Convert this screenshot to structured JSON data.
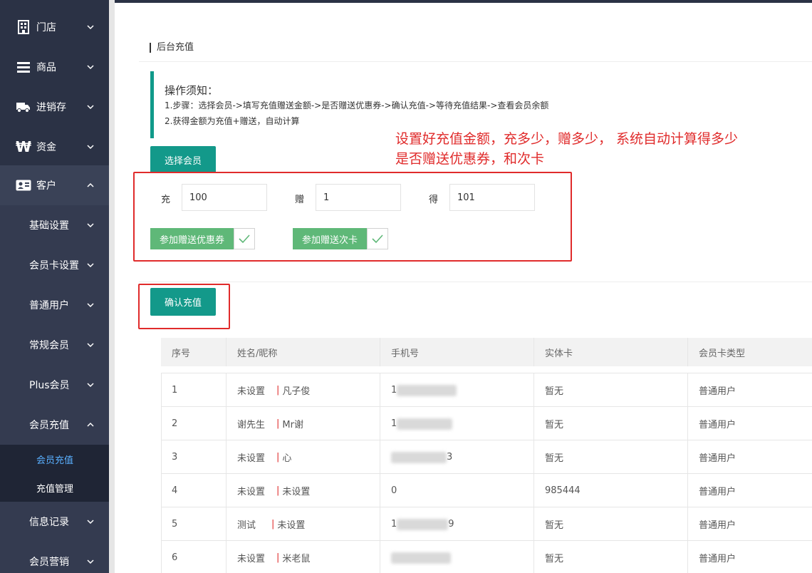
{
  "sidebar": {
    "items": [
      {
        "label": "门店",
        "icon": "building-icon"
      },
      {
        "label": "商品",
        "icon": "list-icon"
      },
      {
        "label": "进销存",
        "icon": "truck-icon"
      },
      {
        "label": "资金",
        "icon": "won-icon"
      },
      {
        "label": "客户",
        "icon": "id-card-icon"
      }
    ],
    "sub_items": [
      {
        "label": "基础设置"
      },
      {
        "label": "会员卡设置"
      },
      {
        "label": "普通用户"
      },
      {
        "label": "常规会员"
      },
      {
        "label": "Plus会员"
      },
      {
        "label": "会员充值"
      }
    ],
    "leaf_items": [
      {
        "label": "会员充值"
      },
      {
        "label": "充值管理"
      }
    ],
    "more_items": [
      {
        "label": "信息记录"
      },
      {
        "label": "会员营销"
      }
    ]
  },
  "breadcrumb": "后台充值",
  "notice": {
    "title": "操作须知：",
    "line1": "1.步骤：选择会员->填写充值赠送金额->是否赠送优惠券->确认充值->等待充值结果->查看会员余额",
    "line2": "2.获得金额为充值+赠送，自动计算"
  },
  "annotation": {
    "line1": "设置好充值金额，充多少，赠多少， 系统自动计算得多少",
    "line2": "是否赠送优惠券，和次卡"
  },
  "select_member_button": "选择会员",
  "form": {
    "charge_label": "充",
    "charge_value": "100",
    "gift_label": "赠",
    "gift_value": "1",
    "get_label": "得",
    "get_value": "101",
    "coupon_toggle": "参加赠送优惠券",
    "card_toggle": "参加赠送次卡"
  },
  "confirm_button": "确认充值",
  "table": {
    "headers": [
      "序号",
      "姓名/昵称",
      "手机号",
      "实体卡",
      "会员卡类型"
    ],
    "rows": [
      {
        "no": "1",
        "name": "未设置",
        "nick": "凡子俊",
        "phone_prefix": "1",
        "phone_suffix": "",
        "card": "暂无",
        "type": "普通用户"
      },
      {
        "no": "2",
        "name": "谢先生",
        "nick": "Mr谢",
        "phone_prefix": "1",
        "phone_suffix": "",
        "card": "暂无",
        "type": "普通用户"
      },
      {
        "no": "3",
        "name": "未设置",
        "nick": "心",
        "phone_prefix": "",
        "phone_suffix": "3",
        "card": "暂无",
        "type": "普通用户"
      },
      {
        "no": "4",
        "name": "未设置",
        "nick": "未设置",
        "phone_prefix": "0",
        "phone_suffix": "",
        "card": "985444",
        "type": "普通用户"
      },
      {
        "no": "5",
        "name": "测试",
        "nick": "未设置",
        "phone_prefix": "1",
        "phone_suffix": "9",
        "card": "暂无",
        "type": "普通用户"
      },
      {
        "no": "6",
        "name": "未设置",
        "nick": "米老鼠",
        "phone_prefix": "",
        "phone_suffix": "",
        "card": "暂无",
        "type": "普通用户"
      }
    ]
  },
  "colors": {
    "sidebar_bg": "#2b3245",
    "teal": "#13998a",
    "green_toggle": "#5fb878",
    "annotation_red": "#e02b2b",
    "active_link": "#5ab0ff"
  }
}
